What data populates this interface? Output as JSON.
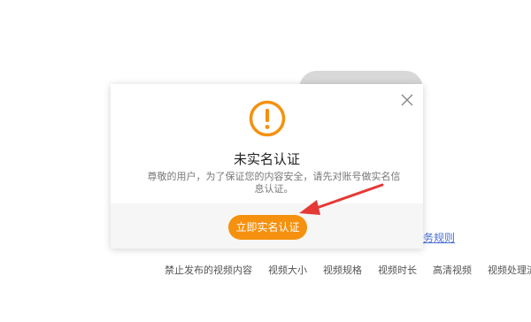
{
  "background": {
    "link_text": "务规则",
    "nav_items": [
      "禁止发布的视频内容",
      "视频大小",
      "视频规格",
      "视频时长",
      "高清视频",
      "视频处理流"
    ]
  },
  "modal": {
    "icon": "warning-circle-icon",
    "title": "未实名认证",
    "description": "尊敬的用户，为了保证您的内容安全，请先对账号做实名信息认证。",
    "button_label": "立即实名认证",
    "close_icon": "close-icon"
  },
  "colors": {
    "accent": "#f5910f",
    "annotation_arrow": "#e53935"
  }
}
